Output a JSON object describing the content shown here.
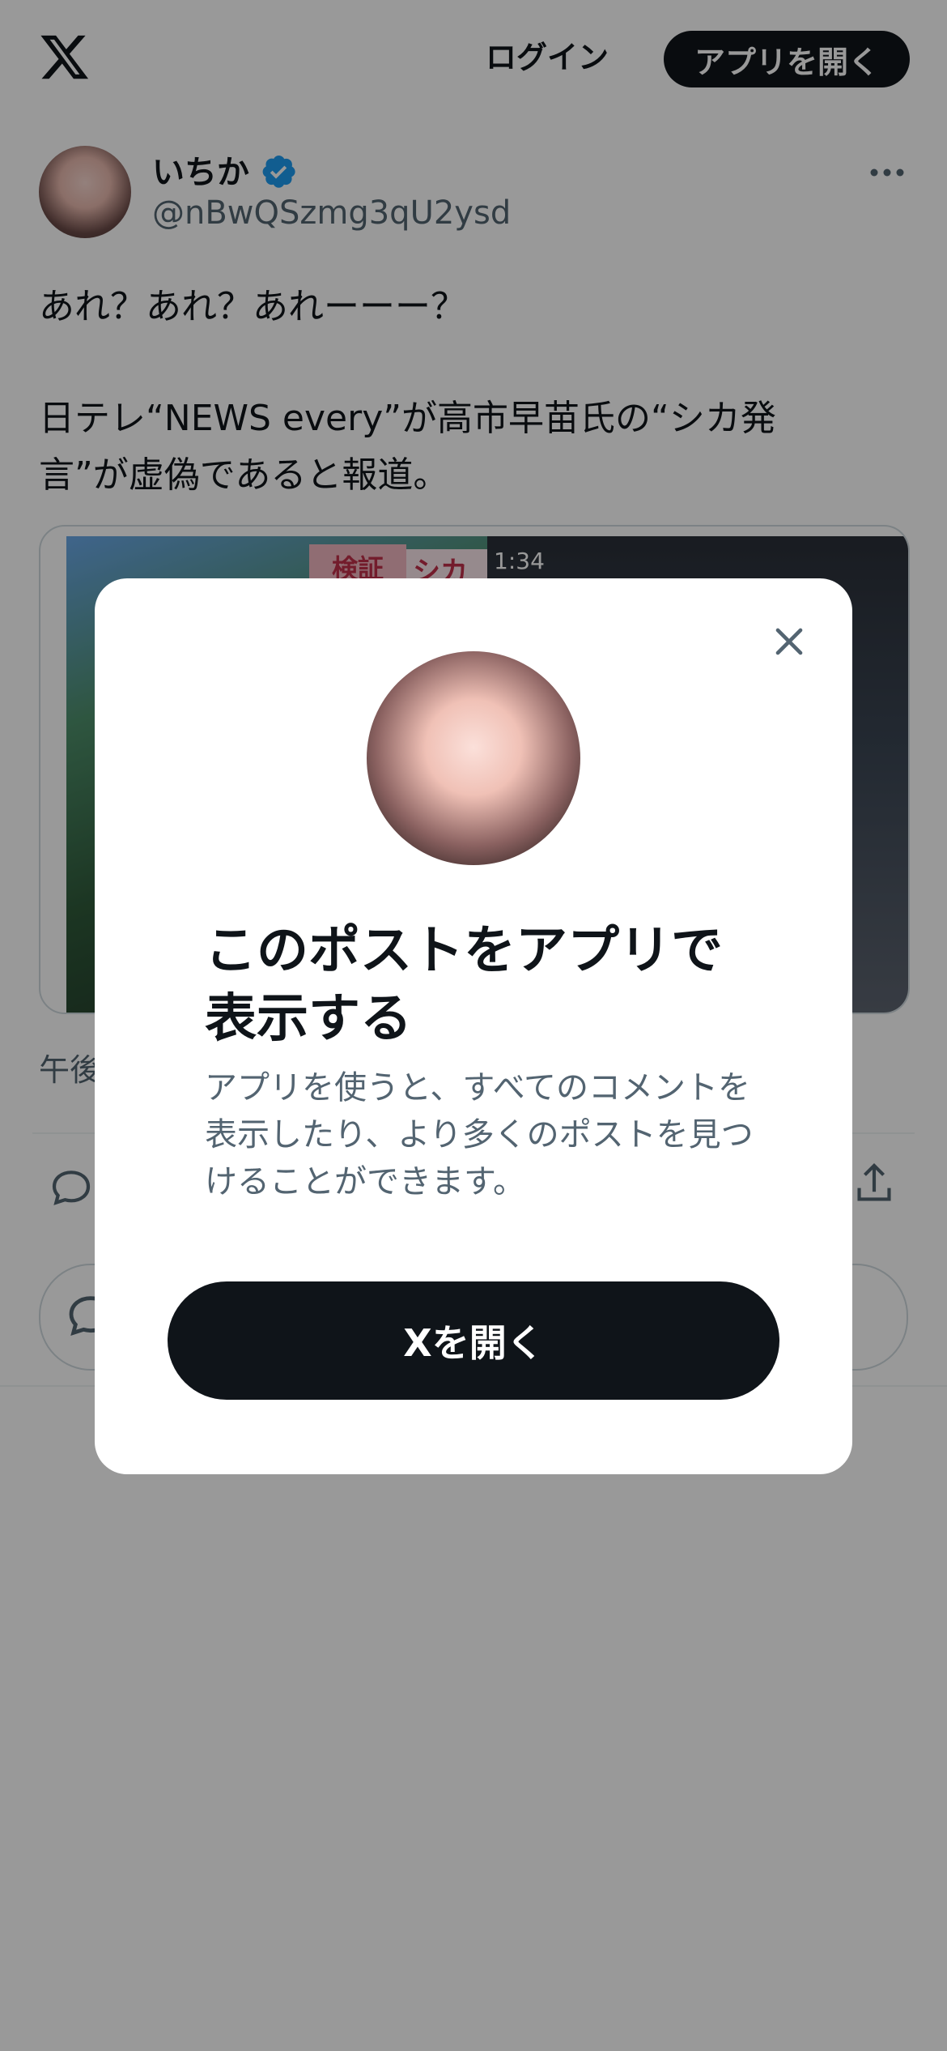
{
  "header": {
    "login_label": "ログイン",
    "open_app_label": "アプリを開く"
  },
  "post": {
    "author_name": "いちか",
    "author_handle": "@nBwQSzmg3qU2ysd",
    "text_lines": [
      "あれ？あれ？あれーーー？",
      "日テレ“NEWS every”が高市早苗氏の“シカ発",
      "言”が虚偽であると報道。"
    ],
    "media": {
      "timer": "1:34",
      "tag": "検証",
      "caption": "シカ暴"
    },
    "timestamp": "午後"
  },
  "modal": {
    "title": "このポストをアプリで表示する",
    "description": "アプリを使うと、すべてのコメントを表示したり、より多くのポストを見つけることができます。",
    "button_label": "Xを開く"
  },
  "colors": {
    "primary_text": "#0f1419",
    "secondary_text": "#536471",
    "verified_blue": "#1d9bf0",
    "button_dark": "#0f1419",
    "overlay": "rgba(0,0,0,0.4)"
  },
  "icons": [
    "x-logo-icon",
    "verified-badge-icon",
    "more-icon",
    "reply-icon",
    "share-icon",
    "close-icon"
  ]
}
